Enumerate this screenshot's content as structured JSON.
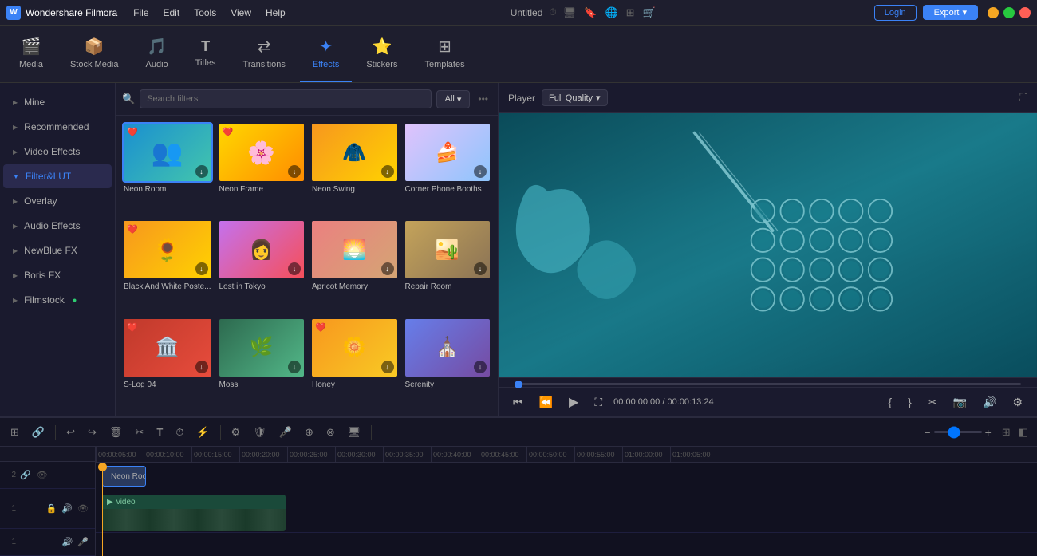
{
  "app": {
    "name": "Wondershare Filmora",
    "title": "Untitled"
  },
  "titlebar": {
    "menu": [
      "File",
      "Edit",
      "Tools",
      "View",
      "Help"
    ],
    "login_label": "Login",
    "export_label": "Export"
  },
  "toolbar": {
    "items": [
      {
        "id": "media",
        "label": "Media",
        "icon": "🎬"
      },
      {
        "id": "stock-media",
        "label": "Stock Media",
        "icon": "📦"
      },
      {
        "id": "audio",
        "label": "Audio",
        "icon": "🎵"
      },
      {
        "id": "titles",
        "label": "Titles",
        "icon": "T"
      },
      {
        "id": "transitions",
        "label": "Transitions",
        "icon": "↔"
      },
      {
        "id": "effects",
        "label": "Effects",
        "icon": "✦"
      },
      {
        "id": "stickers",
        "label": "Stickers",
        "icon": "⭐"
      },
      {
        "id": "templates",
        "label": "Templates",
        "icon": "⊞"
      }
    ],
    "active": "effects"
  },
  "sidebar": {
    "items": [
      {
        "id": "mine",
        "label": "Mine"
      },
      {
        "id": "recommended",
        "label": "Recommended"
      },
      {
        "id": "video-effects",
        "label": "Video Effects"
      },
      {
        "id": "filter-lut",
        "label": "Filter&LUT",
        "active": true
      },
      {
        "id": "overlay",
        "label": "Overlay"
      },
      {
        "id": "audio-effects",
        "label": "Audio Effects"
      },
      {
        "id": "newblue-fx",
        "label": "NewBlue FX"
      },
      {
        "id": "boris-fx",
        "label": "Boris FX"
      },
      {
        "id": "filmstock",
        "label": "Filmstock"
      }
    ]
  },
  "effects": {
    "search_placeholder": "Search filters",
    "filter_label": "All",
    "items": [
      {
        "id": "neon-room",
        "label": "Neon Room",
        "selected": true,
        "badge": "❤️",
        "thumb_class": "thumb-neon-room"
      },
      {
        "id": "neon-frame",
        "label": "Neon Frame",
        "badge": "❤️",
        "thumb_class": "thumb-neon-frame"
      },
      {
        "id": "neon-swing",
        "label": "Neon Swing",
        "thumb_class": "thumb-neon-swing"
      },
      {
        "id": "corner-phone",
        "label": "Corner Phone Booths",
        "thumb_class": "thumb-corner-phone"
      },
      {
        "id": "bw-poster",
        "label": "Black And White Poste...",
        "badge": "❤️",
        "thumb_class": "thumb-bw-poster"
      },
      {
        "id": "lost-tokyo",
        "label": "Lost in Tokyo",
        "thumb_class": "thumb-lost-tokyo"
      },
      {
        "id": "apricot",
        "label": "Apricot Memory",
        "thumb_class": "thumb-apricot"
      },
      {
        "id": "repair-room",
        "label": "Repair Room",
        "thumb_class": "thumb-repair-room"
      },
      {
        "id": "s-log",
        "label": "S-Log 04",
        "badge": "❤️",
        "thumb_class": "thumb-s-log"
      },
      {
        "id": "moss",
        "label": "Moss",
        "thumb_class": "thumb-moss"
      },
      {
        "id": "honey",
        "label": "Honey",
        "badge": "❤️",
        "thumb_class": "thumb-honey"
      },
      {
        "id": "serenity",
        "label": "Serenity",
        "thumb_class": "thumb-serenity"
      }
    ]
  },
  "preview": {
    "player_label": "Player",
    "quality_label": "Full Quality",
    "time_current": "00:00:00:00",
    "time_separator": "/",
    "time_total": "00:00:13:24",
    "progress_percent": 0
  },
  "timeline": {
    "tracks": [
      {
        "num": "2",
        "type": "effect",
        "label": "Neon Room"
      },
      {
        "num": "1",
        "type": "video",
        "label": "Video"
      },
      {
        "num": "1",
        "type": "audio"
      }
    ],
    "ruler_marks": [
      "00:00:05:00",
      "00:00:10:00",
      "00:00:15:00",
      "00:00:20:00",
      "00:00:25:00",
      "00:00:30:00",
      "00:00:35:00",
      "00:00:40:00",
      "00:00:45:00",
      "00:00:50:00",
      "00:00:55:00",
      "01:00:00:00",
      "01:00:05:00"
    ]
  },
  "icons": {
    "search": "🔍",
    "chevron_down": "▾",
    "more": "•••",
    "heart": "❤",
    "download": "↓",
    "play": "▶",
    "pause": "⏸",
    "rewind": "⏮",
    "fast_forward": "⏭",
    "fullscreen": "⛶",
    "scissors": "✂",
    "undo": "↩",
    "redo": "↪",
    "trash": "🗑",
    "text": "T",
    "timer": "⏱",
    "settings": "⚙",
    "lock": "🔒",
    "mic": "🎤",
    "camera": "📷",
    "speaker": "🔊",
    "eye": "👁",
    "link": "🔗",
    "zoom_in": "+",
    "zoom_out": "−",
    "grid": "⊞"
  },
  "colors": {
    "accent": "#3b82f6",
    "bg_dark": "#1a1a2e",
    "bg_medium": "#1e1e2e",
    "text_primary": "#ffffff",
    "text_secondary": "#aaaaaa",
    "timeline_bg": "#111120",
    "selected_border": "#3b82f6"
  }
}
